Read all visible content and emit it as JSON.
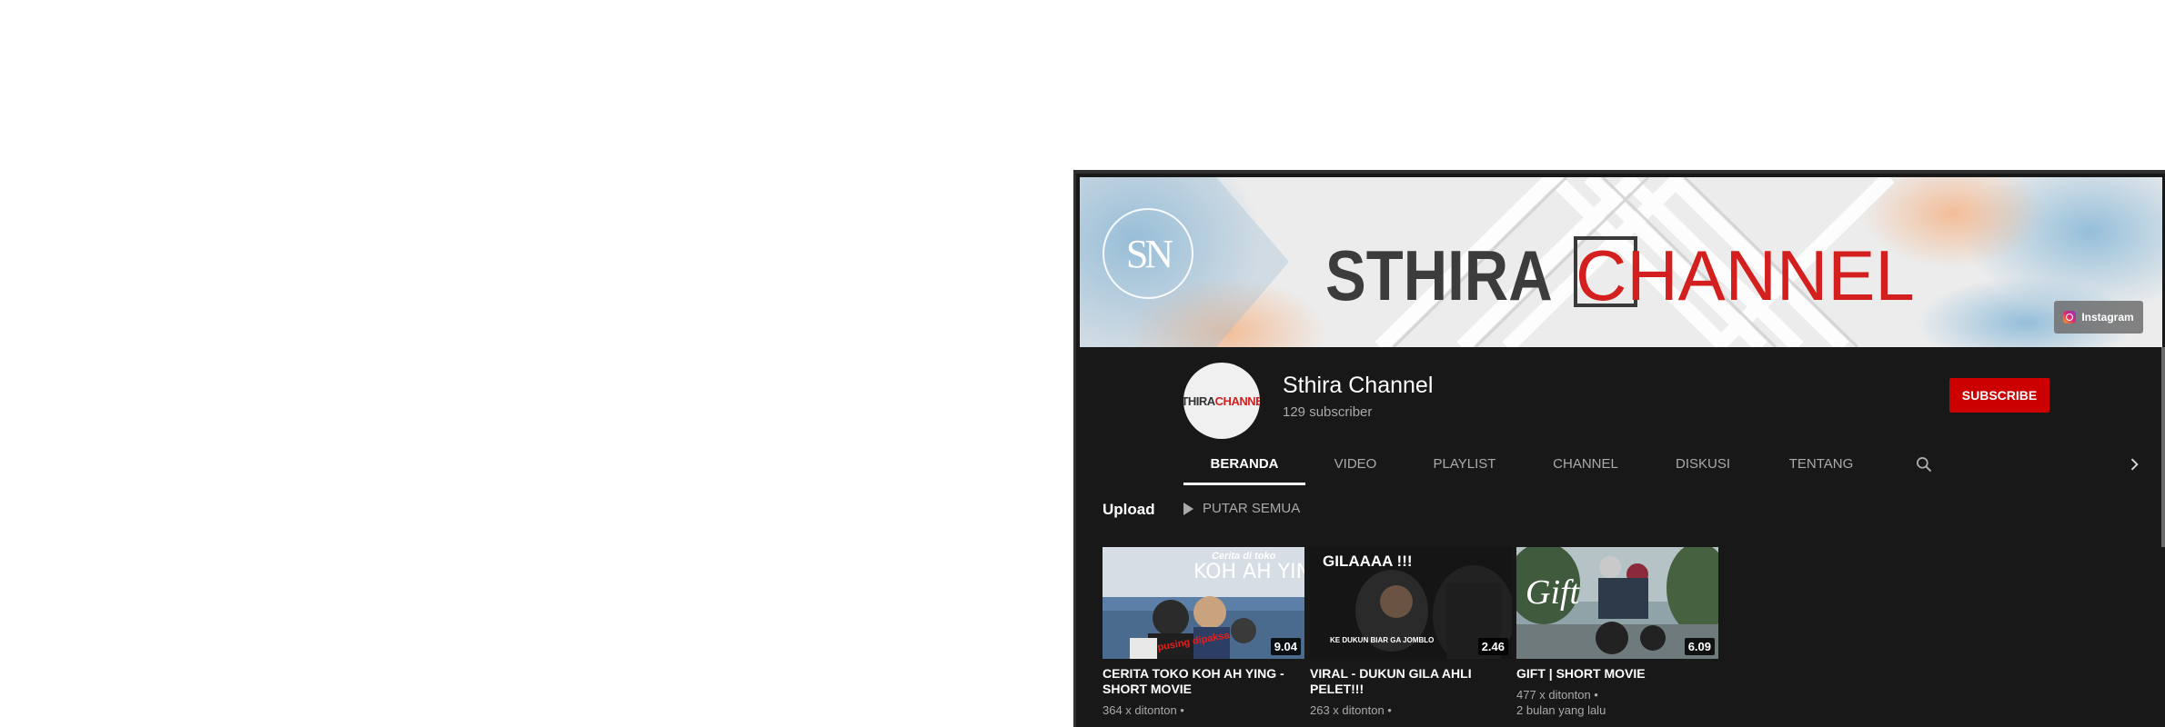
{
  "banner": {
    "logo_text": "SN",
    "title_left": "STHIRA",
    "title_right": "CHANNEL",
    "instagram_label": "Instagram"
  },
  "channel": {
    "avatar_text_left": "STHIRA",
    "avatar_text_right": "CHANNEL",
    "name": "Sthira Channel",
    "subscribers": "129 subscriber",
    "subscribe_label": "SUBSCRIBE"
  },
  "tabs": [
    {
      "label": "BERANDA",
      "active": true
    },
    {
      "label": "VIDEO",
      "active": false
    },
    {
      "label": "PLAYLIST",
      "active": false
    },
    {
      "label": "CHANNEL",
      "active": false
    },
    {
      "label": "DISKUSI",
      "active": false
    },
    {
      "label": "TENTANG",
      "active": false
    }
  ],
  "section": {
    "title": "Upload",
    "play_all_label": "PUTAR SEMUA"
  },
  "videos": [
    {
      "title": "CERITA TOKO KOH AH YING - SHORT MOVIE",
      "duration": "9.04",
      "views": "364 x ditonton •",
      "age": "",
      "thumb_text_1": "Cerita di toko",
      "thumb_text_2": "KOH AH YING",
      "thumb_text_3": "pusing dipaksa"
    },
    {
      "title": "VIRAL - DUKUN GILA AHLI PELET!!!",
      "duration": "2.46",
      "views": "263 x ditonton •",
      "age": "",
      "thumb_text_1": "GILAAAA !!!",
      "thumb_text_2": "KE DUKUN BIAR GA JOMBLO"
    },
    {
      "title": "GIFT | SHORT MOVIE",
      "duration": "6.09",
      "views": "477 x ditonton •",
      "age": "2 bulan yang lalu",
      "thumb_text_1": "Gift"
    }
  ],
  "colors": {
    "background": "#181818",
    "subscribe": "#cc0000",
    "accent_red": "#d41f1f"
  }
}
